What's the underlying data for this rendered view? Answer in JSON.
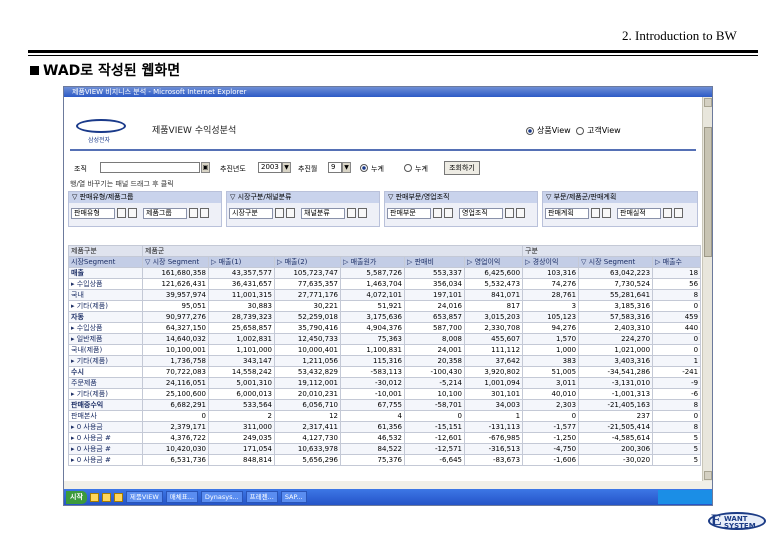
{
  "slide": {
    "header": "2. Introduction to BW",
    "subtitle": "WAD로 작성된 웹화면"
  },
  "browser": {
    "title": "제품VIEW 비지니스 분석 - Microsoft Internet Explorer"
  },
  "app": {
    "report_title": "제품VIEW 수익성분석",
    "logo_sub": "삼성전자",
    "view_options": [
      {
        "label": "상품View",
        "selected": true
      },
      {
        "label": "고객View",
        "selected": false
      }
    ]
  },
  "filters": {
    "label1": "조직",
    "label2": "추진년도",
    "year_value": "2003",
    "label3": "추진월",
    "month_value": "9",
    "radio1": "누계",
    "radio2": "누계",
    "query_button": "조회하기"
  },
  "hint": "행/열 바꾸기는 패널 드래그 후 클릭",
  "zones": [
    {
      "title": "판매유형/제품그룹",
      "fields": [
        "판매유형",
        "제품그룹"
      ]
    },
    {
      "title": "시장구분/채널분류",
      "fields": [
        "시장구분",
        "채널분류"
      ]
    },
    {
      "title": "판매부문/영업조직",
      "fields": [
        "판매부문",
        "영업조직"
      ]
    },
    {
      "title": "부문/제품군/판매계획",
      "fields": [
        "판매계획",
        "판매실적"
      ]
    }
  ],
  "table": {
    "meta_left": "제품구분",
    "meta_mid": "제품군",
    "meta_right": "구분",
    "headers": [
      "시장Segment",
      "시장 Segment",
      "매출(1)",
      "매출(2)",
      "매출원가",
      "판매비",
      "영업이익",
      "경상이익",
      "시장 Segment",
      "매출수"
    ],
    "rows": [
      {
        "label": "매출",
        "group": true,
        "values": [
          "161,680,358",
          "43,357,577",
          "105,723,747",
          "5,587,726",
          "553,337",
          "6,425,600",
          "103,316",
          "63,042,223",
          "18"
        ]
      },
      {
        "label": "▸ 수입상품",
        "group": false,
        "values": [
          "121,626,431",
          "36,431,657",
          "77,635,357",
          "1,463,704",
          "356,034",
          "5,532,473",
          "74,276",
          "7,730,524",
          "56"
        ]
      },
      {
        "label": "  국내",
        "group": false,
        "values": [
          "39,957,974",
          "11,001,315",
          "27,771,176",
          "4,072,101",
          "197,101",
          "841,071",
          "28,761",
          "55,281,641",
          "8"
        ]
      },
      {
        "label": "▸ 기타(제품)",
        "group": false,
        "values": [
          "95,051",
          "30,883",
          "30,221",
          "51,921",
          "24,016",
          "817",
          "3",
          "3,185,316",
          "0"
        ]
      },
      {
        "label": "자동",
        "group": true,
        "values": [
          "90,977,276",
          "28,739,323",
          "52,259,018",
          "3,175,636",
          "653,857",
          "3,015,203",
          "105,123",
          "57,583,316",
          "459"
        ]
      },
      {
        "label": "▸ 수입상품",
        "group": false,
        "values": [
          "64,327,150",
          "25,658,857",
          "35,790,416",
          "4,904,376",
          "587,700",
          "2,330,708",
          "94,276",
          "2,403,310",
          "440"
        ]
      },
      {
        "label": "▸ 일반제품",
        "group": false,
        "values": [
          "14,640,032",
          "1,002,831",
          "12,450,733",
          "75,363",
          "8,008",
          "455,607",
          "1,570",
          "224,270",
          "0"
        ]
      },
      {
        "label": "  국내(제품)",
        "group": false,
        "values": [
          "10,100,001",
          "1,101,000",
          "10,000,401",
          "1,100,831",
          "24,001",
          "111,112",
          "1,000",
          "1,021,000",
          "0"
        ]
      },
      {
        "label": "▸ 기타(제품)",
        "group": false,
        "values": [
          "1,736,758",
          "343,147",
          "1,211,056",
          "115,316",
          "20,358",
          "37,642",
          "383",
          "3,403,316",
          "1"
        ]
      },
      {
        "label": "수시",
        "group": true,
        "values": [
          "70,722,083",
          "14,558,242",
          "53,432,829",
          "-583,113",
          "-100,430",
          "3,920,802",
          "51,005",
          "-34,541,286",
          "-241"
        ]
      },
      {
        "label": "  주문제품",
        "group": false,
        "values": [
          "24,116,051",
          "5,001,310",
          "19,112,001",
          "-30,012",
          "-5,214",
          "1,001,094",
          "3,011",
          "-3,131,010",
          "-9"
        ]
      },
      {
        "label": "▸ 기타(제품)",
        "group": false,
        "values": [
          "25,100,600",
          "6,000,013",
          "20,010,231",
          "-10,001",
          "10,100",
          "301,101",
          "40,010",
          "-1,001,313",
          "-6"
        ]
      },
      {
        "label": "판매중수익",
        "group": true,
        "values": [
          "6,682,291",
          "533,564",
          "6,056,710",
          "67,755",
          "-58,701",
          "34,003",
          "2,303",
          "-21,405,163",
          "8"
        ]
      },
      {
        "label": "  판매본사",
        "group": false,
        "values": [
          "0",
          "2",
          "12",
          "4",
          "0",
          "1",
          "0",
          "237",
          "0"
        ]
      },
      {
        "label": "▸ 0 사용금",
        "group": false,
        "values": [
          "2,379,171",
          "311,000",
          "2,317,411",
          "61,356",
          "-15,151",
          "-131,113",
          "-1,577",
          "-21,505,414",
          "8"
        ]
      },
      {
        "label": "▸ 0 사용금 #",
        "group": false,
        "values": [
          "4,376,722",
          "249,035",
          "4,127,730",
          "46,532",
          "-12,601",
          "-676,985",
          "-1,250",
          "-4,585,614",
          "5"
        ]
      },
      {
        "label": "▸ 0 사용금 #",
        "group": false,
        "values": [
          "10,420,030",
          "171,054",
          "10,633,978",
          "84,522",
          "-12,571",
          "-316,513",
          "-4,750",
          "200,306",
          "5"
        ]
      },
      {
        "label": "▸ 0 사용금 #",
        "group": false,
        "values": [
          "6,531,736",
          "848,814",
          "5,656,296",
          "75,376",
          "-6,645",
          "-83,673",
          "-1,606",
          "-30,020",
          "5"
        ]
      }
    ]
  },
  "taskbar": {
    "start": "시작",
    "tasks": [
      "제품VIEW",
      "매체표...",
      "Dynasys...",
      "프레젠...",
      "SAP..."
    ]
  },
  "footer_logo": {
    "line1": "WANT",
    "line2": "SYSTEM"
  }
}
